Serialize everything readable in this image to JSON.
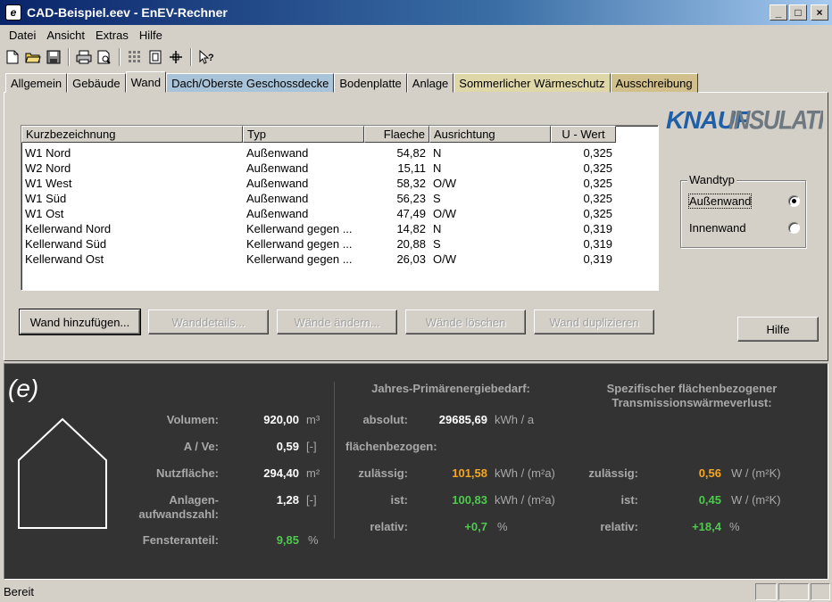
{
  "window": {
    "title": "CAD-Beispiel.eev - EnEV-Rechner",
    "icon_letter": "e",
    "minimize": "_",
    "maximize": "□",
    "close": "×"
  },
  "menu": [
    "Datei",
    "Ansicht",
    "Extras",
    "Hilfe"
  ],
  "toolbar_icons": [
    "new-file-icon",
    "open-folder-icon",
    "save-icon",
    "print-icon",
    "print-preview-icon",
    "grid-icon",
    "frame-icon",
    "crosshair-icon",
    "context-help-icon"
  ],
  "tabs": [
    {
      "label": "Allgemein",
      "style": "normal"
    },
    {
      "label": "Gebäude",
      "style": "normal"
    },
    {
      "label": "Wand",
      "style": "active"
    },
    {
      "label": "Dach/Oberste Geschossdecke",
      "style": "colored"
    },
    {
      "label": "Bodenplatte",
      "style": "normal"
    },
    {
      "label": "Anlage",
      "style": "normal"
    },
    {
      "label": "Sommerlicher Wärmeschutz",
      "style": "tan"
    },
    {
      "label": "Ausschreibung",
      "style": "brown"
    }
  ],
  "logo": {
    "text_a": "KNAUF",
    "text_b": "INSULATION"
  },
  "list": {
    "columns": [
      "Kurzbezeichnung",
      "Typ",
      "Flaeche",
      "Ausrichtung",
      "U - Wert"
    ],
    "rows": [
      [
        "W1 Nord",
        "Außenwand",
        "54,82",
        "N",
        "0,325"
      ],
      [
        "W2 Nord",
        "Außenwand",
        "15,11",
        "N",
        "0,325"
      ],
      [
        "W1 West",
        "Außenwand",
        "58,32",
        "O/W",
        "0,325"
      ],
      [
        "W1 Süd",
        "Außenwand",
        "56,23",
        "S",
        "0,325"
      ],
      [
        "W1 Ost",
        "Außenwand",
        "47,49",
        "O/W",
        "0,325"
      ],
      [
        "Kellerwand Nord",
        "Kellerwand gegen ...",
        "14,82",
        "N",
        "0,319"
      ],
      [
        "Kellerwand Süd",
        "Kellerwand gegen ...",
        "20,88",
        "S",
        "0,319"
      ],
      [
        "Kellerwand Ost",
        "Kellerwand gegen ...",
        "26,03",
        "O/W",
        "0,319"
      ]
    ]
  },
  "buttons": {
    "add": "Wand hinzufügen...",
    "details": "Wanddetails...",
    "change": "Wände ändern...",
    "delete": "Wände löschen",
    "duplicate": "Wand duplizieren",
    "help": "Hilfe"
  },
  "wandtyp": {
    "legend": "Wandtyp",
    "options": [
      "Außenwand",
      "Innenwand"
    ],
    "selected": "Außenwand"
  },
  "summary": {
    "logo": "(e)",
    "volumen": {
      "label": "Volumen:",
      "value": "920,00",
      "unit": "m³"
    },
    "ave": {
      "label": "A / Ve:",
      "value": "0,59",
      "unit": "[-]"
    },
    "nutzflaeche": {
      "label": "Nutzfläche:",
      "value": "294,40",
      "unit": "m²"
    },
    "anlagen": {
      "label": "Anlagen-\naufwandszahl:",
      "value": "1,28",
      "unit": "[-]"
    },
    "fenster": {
      "label": "Fensteranteil:",
      "value": "9,85",
      "unit": "%"
    },
    "primaer": {
      "heading": "Jahres-Primärenergiebedarf:",
      "absolut_label": "absolut:",
      "absolut_value": "29685,69",
      "absolut_unit": "kWh / a",
      "flaechen_label": "flächenbezogen:",
      "zul_label": "zulässig:",
      "zul_value": "101,58",
      "zul_unit": "kWh / (m²a)",
      "ist_label": "ist:",
      "ist_value": "100,83",
      "ist_unit": "kWh / (m²a)",
      "rel_label": "relativ:",
      "rel_value": "+0,7",
      "rel_unit": "%"
    },
    "transmission": {
      "heading": "Spezifischer flächenbezogener\nTransmissionswärmeverlust:",
      "zul_label": "zulässig:",
      "zul_value": "0,56",
      "zul_unit": "W / (m²K)",
      "ist_label": "ist:",
      "ist_value": "0,45",
      "ist_unit": "W / (m²K)",
      "rel_label": "relativ:",
      "rel_value": "+18,4",
      "rel_unit": "%"
    }
  },
  "status": {
    "text": "Bereit"
  }
}
